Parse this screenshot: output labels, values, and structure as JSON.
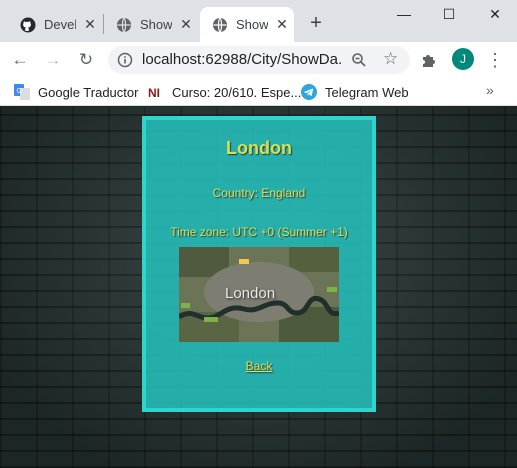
{
  "browser": {
    "tabs": [
      {
        "title": "Devel",
        "icon": "github-icon",
        "active": false
      },
      {
        "title": "Show",
        "icon": "globe-icon",
        "active": false
      },
      {
        "title": "Show",
        "icon": "globe-icon",
        "active": true
      }
    ],
    "new_tab_label": "+",
    "address_bar": {
      "url": "localhost:62988/City/ShowDa..."
    },
    "profile_initial": "J",
    "bookmarks": [
      {
        "label": "Google Traductor",
        "icon": "google-translate-icon"
      },
      {
        "label": "Curso: 20/610. Espe...",
        "icon": "ni-icon"
      },
      {
        "label": "Telegram Web",
        "icon": "telegram-icon"
      }
    ]
  },
  "page": {
    "city_name": "London",
    "country_line": "Country: England",
    "timezone_line": "Time zone: UTC +0 (Summer +1)",
    "map_label": "London",
    "back_link": "Back"
  },
  "colors": {
    "card_bg": "#24beba",
    "card_border": "#2fd4cf",
    "text_accent": "#d4e157",
    "avatar": "#00897b"
  }
}
